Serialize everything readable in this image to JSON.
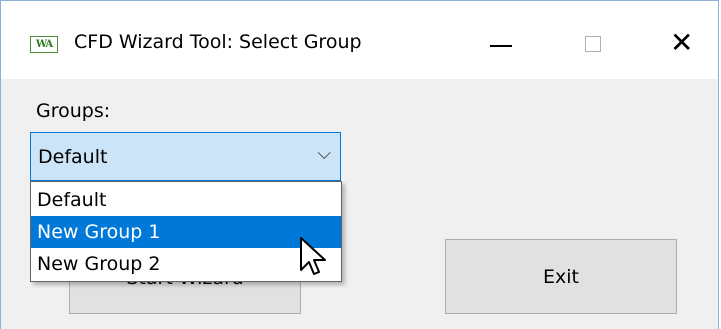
{
  "window": {
    "title": "CFD Wizard Tool: Select Group",
    "icon_text": "WA",
    "controls": {
      "minimize": "minimize-icon",
      "maximize": "maximize-icon",
      "close": "close-icon",
      "close_glyph": "✕"
    }
  },
  "form": {
    "groups_label": "Groups:",
    "selected_group": "Default",
    "dropdown_icon": "chevron-down-icon",
    "dropdown_glyph": "⌵",
    "options": [
      "Default",
      "New Group 1",
      "New Group 2"
    ],
    "highlighted_option": "New Group 1"
  },
  "buttons": {
    "start_label": "Start Wizard",
    "exit_label": "Exit"
  },
  "colors": {
    "accent": "#0078d7",
    "combo_bg": "#cce4f7"
  }
}
